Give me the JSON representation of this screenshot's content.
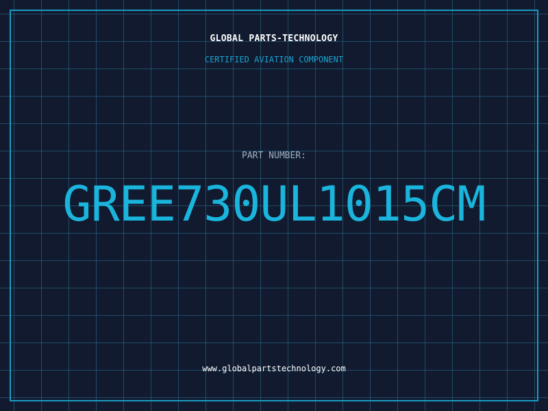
{
  "header": {
    "brand": "GLOBAL PARTS-TECHNOLOGY",
    "tagline": "CERTIFIED AVIATION COMPONENT"
  },
  "part": {
    "label": "PART NUMBER:",
    "number": "GREE730UL1015CM"
  },
  "footer": {
    "website": "www.globalpartstechnology.com"
  },
  "colors": {
    "background": "#111a2e",
    "grid": "#265c7a",
    "frame": "#1a9cc4",
    "accent": "#1ab4dc",
    "label": "#9fb1c4",
    "text": "#ffffff"
  }
}
